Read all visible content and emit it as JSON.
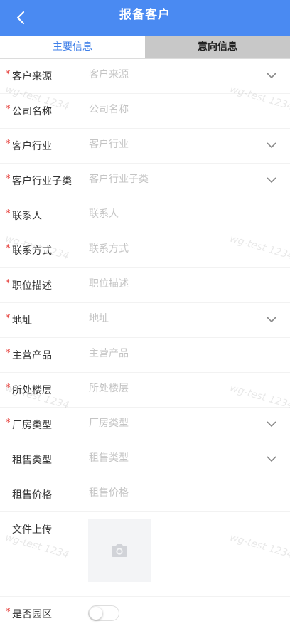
{
  "header": {
    "title": "报备客户",
    "back_icon": "chevron-left-icon"
  },
  "tabs": [
    {
      "label": "主要信息",
      "active": true
    },
    {
      "label": "意向信息",
      "active": false
    }
  ],
  "form": {
    "fields": [
      {
        "label": "客户来源",
        "placeholder": "客户来源",
        "required": true,
        "dropdown": true
      },
      {
        "label": "公司名称",
        "placeholder": "公司名称",
        "required": true,
        "dropdown": false
      },
      {
        "label": "客户行业",
        "placeholder": "客户行业",
        "required": true,
        "dropdown": true
      },
      {
        "label": "客户行业子类",
        "placeholder": "客户行业子类",
        "required": true,
        "dropdown": true
      },
      {
        "label": "联系人",
        "placeholder": "联系人",
        "required": true,
        "dropdown": false
      },
      {
        "label": "联系方式",
        "placeholder": "联系方式",
        "required": true,
        "dropdown": false
      },
      {
        "label": "职位描述",
        "placeholder": "职位描述",
        "required": true,
        "dropdown": false
      },
      {
        "label": "地址",
        "placeholder": "地址",
        "required": true,
        "dropdown": true
      },
      {
        "label": "主营产品",
        "placeholder": "主营产品",
        "required": true,
        "dropdown": false
      },
      {
        "label": "所处楼层",
        "placeholder": "所处楼层",
        "required": true,
        "dropdown": false
      },
      {
        "label": "厂房类型",
        "placeholder": "厂房类型",
        "required": true,
        "dropdown": true
      },
      {
        "label": "租售类型",
        "placeholder": "租售类型",
        "required": false,
        "dropdown": true
      },
      {
        "label": "租售价格",
        "placeholder": "租售价格",
        "required": false,
        "dropdown": false
      }
    ],
    "required_mark": "*",
    "upload": {
      "label": "文件上传",
      "icon": "camera-icon"
    },
    "park_toggle": {
      "label": "是否园区",
      "required": true,
      "on": false
    }
  },
  "watermark": "wg-test 1234",
  "colors": {
    "header_bg": "#4a8af2",
    "active_tab": "#3f7fe8",
    "inactive_tab_bg": "#c8c8c8",
    "required": "#e53935",
    "placeholder": "#c4c4c4"
  }
}
